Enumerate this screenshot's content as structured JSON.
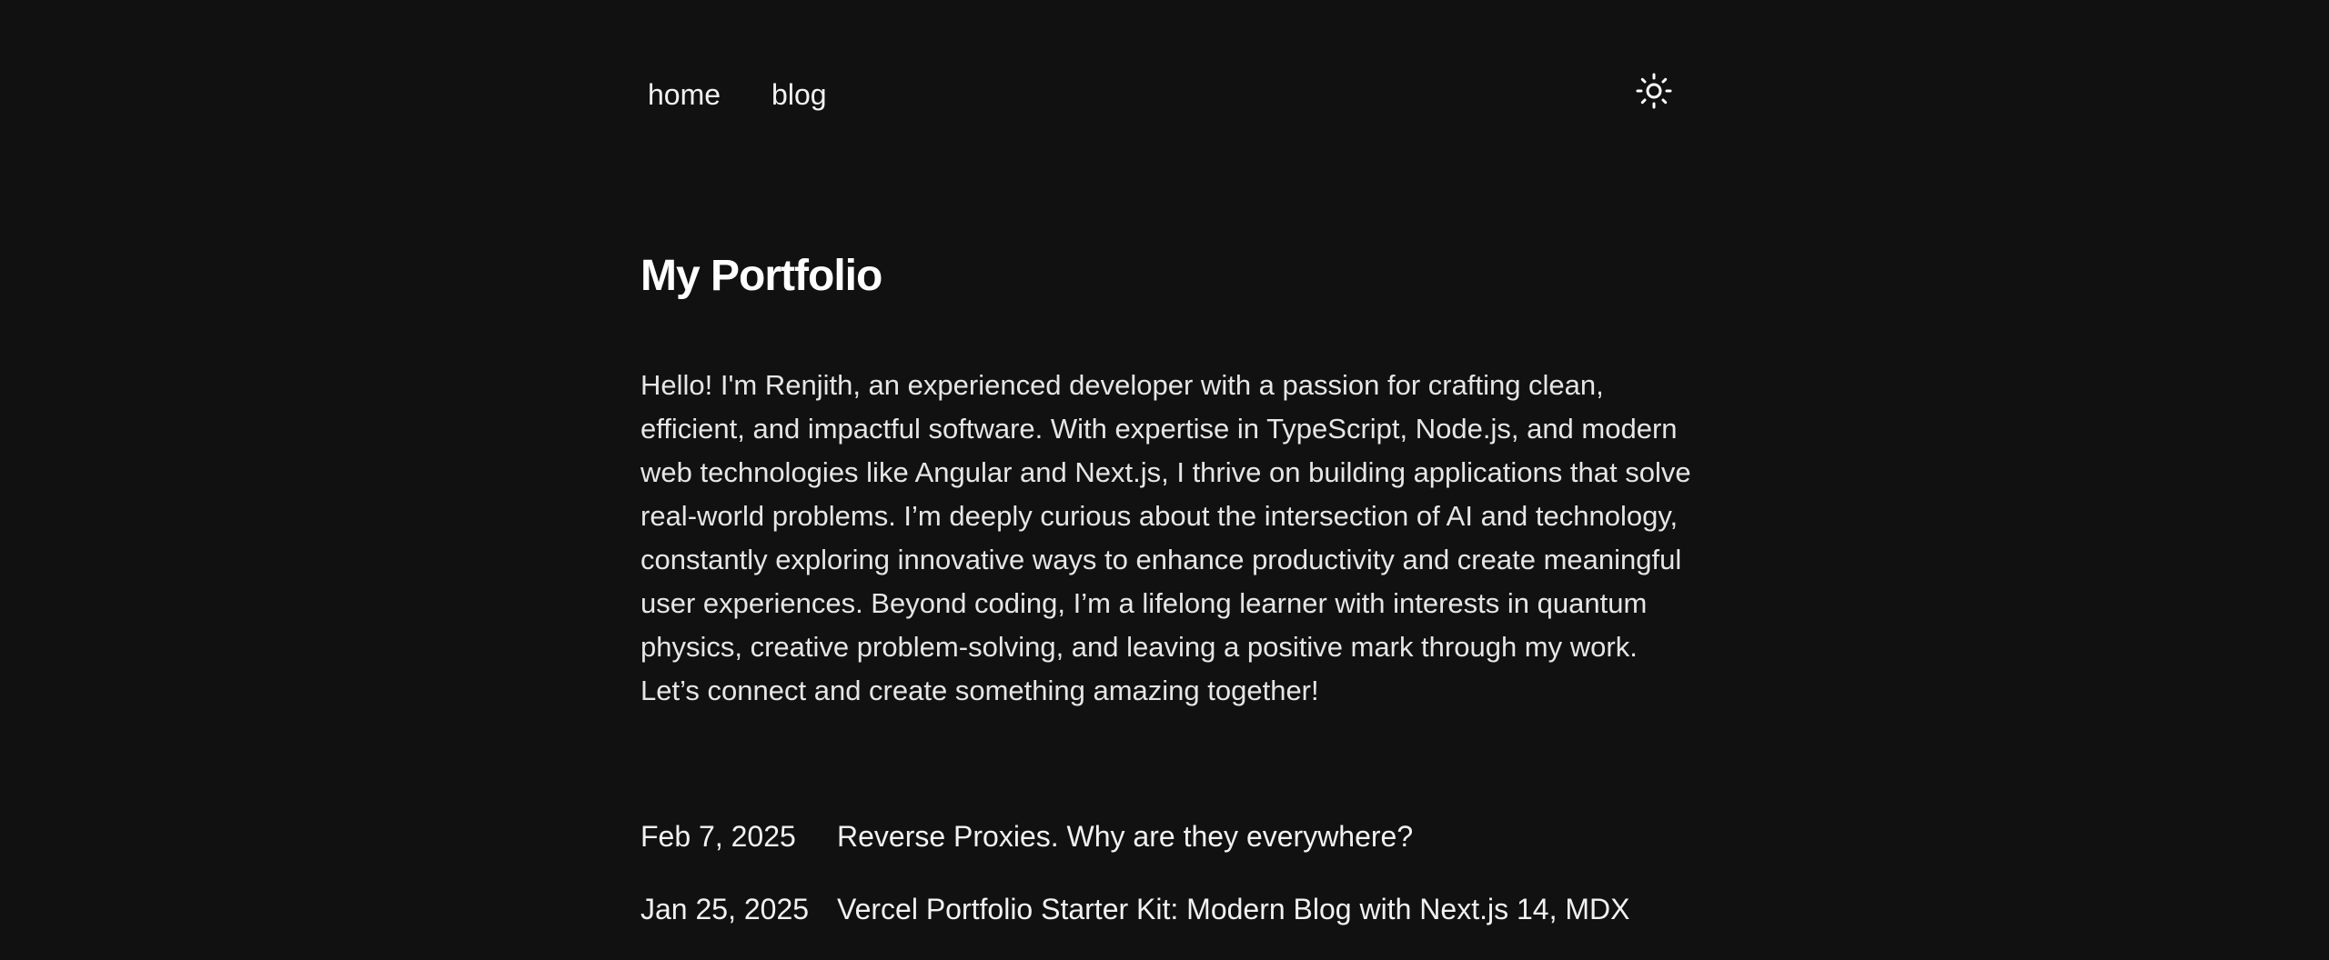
{
  "nav": {
    "items": [
      {
        "label": "home"
      },
      {
        "label": "blog"
      }
    ]
  },
  "theme_toggle": {
    "icon": "sun-icon"
  },
  "main": {
    "title": "My Portfolio",
    "intro": "Hello! I'm Renjith, an experienced developer with a passion for crafting clean, efficient, and impactful software. With expertise in TypeScript, Node.js, and modern web technologies like Angular and Next.js, I thrive on building applications that solve real-world problems. I’m deeply curious about the intersection of AI and technology, constantly exploring innovative ways to enhance productivity and create meaningful user experiences. Beyond coding, I’m a lifelong learner with interests in quantum physics, creative problem-solving, and leaving a positive mark through my work. Let’s connect and create something amazing together!"
  },
  "posts": [
    {
      "date": "Feb 7, 2025",
      "title": "Reverse Proxies. Why are they everywhere?"
    },
    {
      "date": "Jan 25, 2025",
      "title": "Vercel Portfolio Starter Kit: Modern Blog with Next.js 14, MDX"
    }
  ],
  "colors": {
    "background": "#111111",
    "text": "#f2f2f2"
  }
}
